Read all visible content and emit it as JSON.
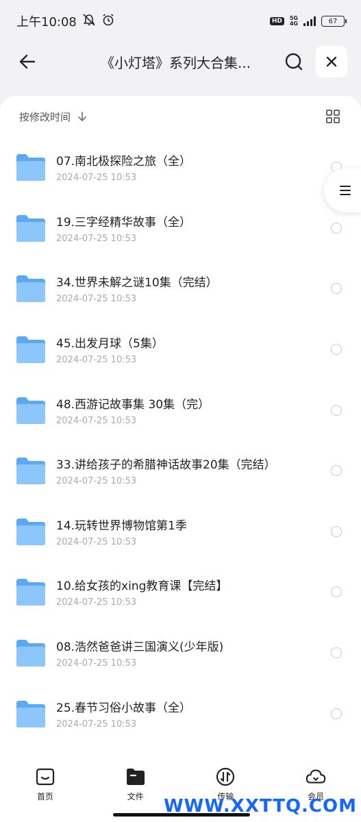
{
  "status_bar": {
    "time": "上午10:08",
    "net_top": "5G",
    "net_bottom": "4G",
    "hd": "HD",
    "battery": "67"
  },
  "header": {
    "title": "《小灯塔》系列大合集..."
  },
  "sort": {
    "label": "按修改时间"
  },
  "files": [
    {
      "name": "07.南北极探险之旅（全）",
      "date": "2024-07-25 10:53"
    },
    {
      "name": "19.三字经精华故事（全）",
      "date": "2024-07-25 10:53"
    },
    {
      "name": "34.世界未解之谜10集（完结）",
      "date": "2024-07-25 10:53"
    },
    {
      "name": "45.出发月球（5集）",
      "date": "2024-07-25 10:53"
    },
    {
      "name": "48.西游记故事集 30集（完）",
      "date": "2024-07-25 10:53"
    },
    {
      "name": "33.讲给孩子的希腊神话故事20集（完结）",
      "date": "2024-07-25 10:53"
    },
    {
      "name": "14.玩转世界博物馆第1季",
      "date": "2024-07-25 10:53"
    },
    {
      "name": "10.给女孩的xing教育课【完结】",
      "date": "2024-07-25 10:53"
    },
    {
      "name": "08.浩然爸爸讲三国演义(少年版)",
      "date": "2024-07-25 10:53"
    },
    {
      "name": "25.春节习俗小故事（全）",
      "date": "2024-07-25 10:53"
    }
  ],
  "nav": {
    "home": "首页",
    "files": "文件",
    "transfer": "传输",
    "member": "会员"
  },
  "watermark": "WWW.XXTTQ.COM",
  "colors": {
    "folder": "#5aa9f5",
    "watermark": "#1565ff"
  }
}
